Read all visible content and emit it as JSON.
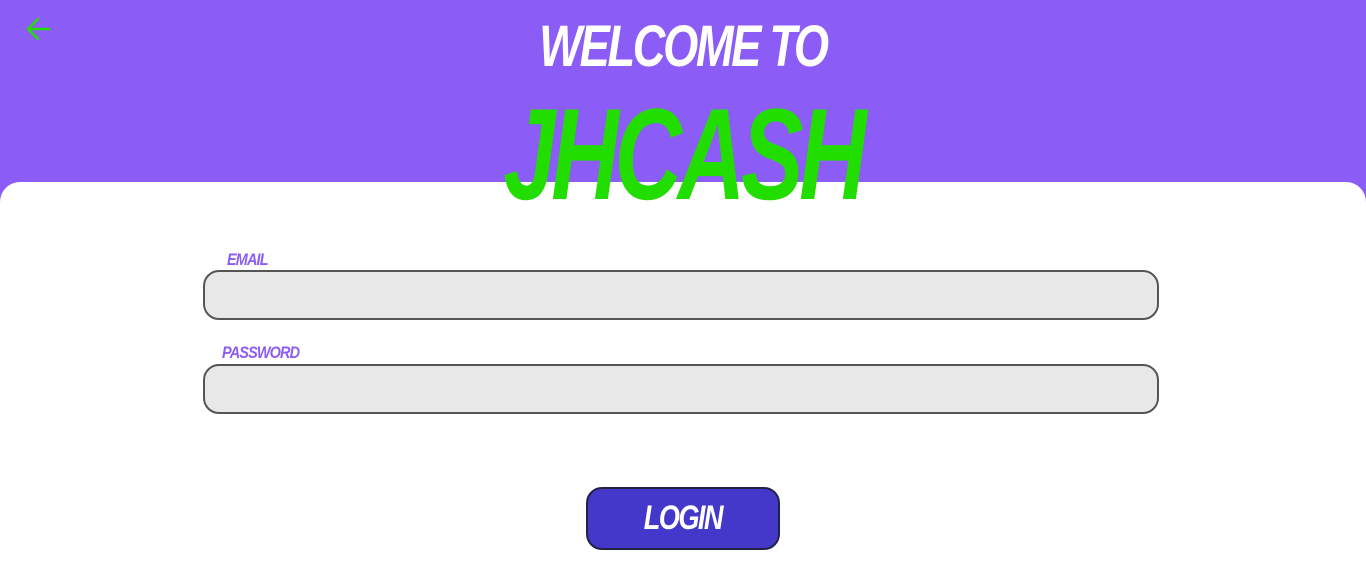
{
  "header": {
    "back_icon": "arrow-left-icon",
    "welcome_text": "WELCOME TO",
    "brand_name": "JHCASH"
  },
  "form": {
    "email": {
      "label": "EMAIL",
      "value": "",
      "placeholder": ""
    },
    "password": {
      "label": "PASSWORD",
      "value": "",
      "placeholder": ""
    },
    "login_label": "LOGIN"
  },
  "colors": {
    "header_background": "#8b5cf6",
    "brand": "#22dd00",
    "label": "#8b5cf6",
    "button": "#4338ca",
    "input_background": "#e8e8e8",
    "card_background": "#ffffff"
  }
}
